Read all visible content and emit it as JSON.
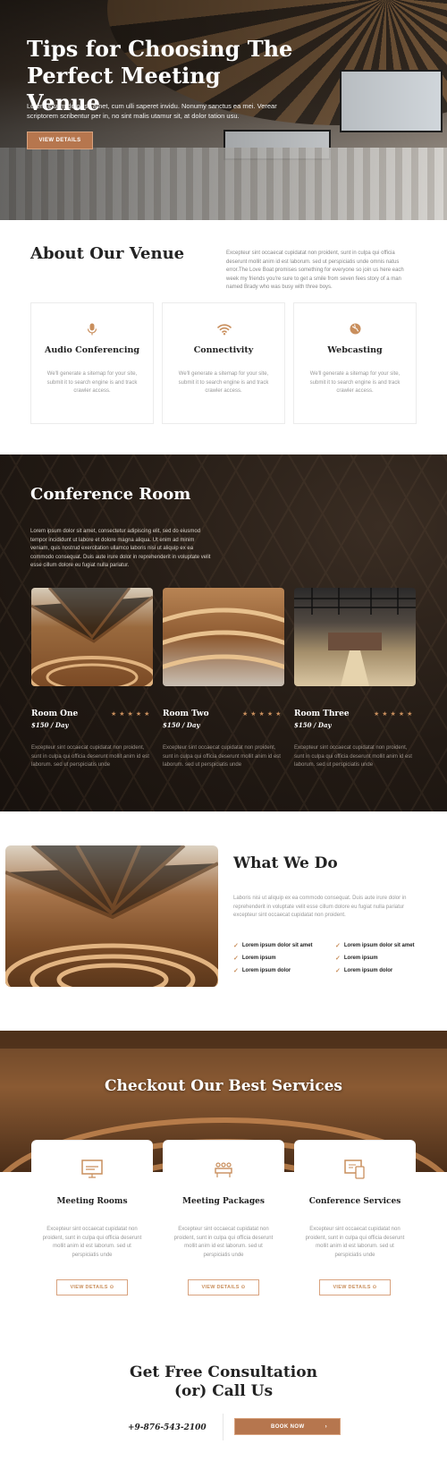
{
  "hero": {
    "title": "Tips for Choosing The Perfect Meeting Venue",
    "text": "Lorem ipsum dolor sit amet, cum ulli saperet invidu. Nonumy sanctus ea mei. Verear scriptorem scribentur per in, no sint malis utamur sit, at dolor tation usu.",
    "button": "VIEW DETAILS"
  },
  "about": {
    "title": "About Our Venue",
    "text": "Excepteur sint occaecat cupidatat non proident, sunt in culpa qui officia deserunt mollit anim id est laborum. sed ut perspiciatis unde omnis natus error.The Love Boat promises something for everyone so join us here each week my friends you're sure to get a smile from seven fees story of a man named Brady who was busy with three boys.",
    "features": [
      {
        "icon": "microphone-icon",
        "title": "Audio Conferencing",
        "text": "We'll generate a sitemap for your site, submit it to search engine is and track crawler access."
      },
      {
        "icon": "wifi-icon",
        "title": "Connectivity",
        "text": "We'll generate a sitemap for your site, submit it to search engine is and track crawler access."
      },
      {
        "icon": "globe-icon",
        "title": "Webcasting",
        "text": "We'll generate a sitemap for your site, submit it to search engine is and track crawler access."
      }
    ]
  },
  "conference": {
    "title": "Conference Room",
    "text": "Lorem ipsum dolor sit amet, consectetur adipiscing elit, sed do eiusmod tempor incididunt ut labore et dolore magna aliqua. Ut enim ad minim veniam, quis nostrud exercitation ullamco laboris nisi ut aliquip ex ea commodo consequat. Duis aute irure dolor in reprehenderit in voluptate velit esse cillum dolore eu fugiat nulla pariatur.",
    "rooms": [
      {
        "name": "Room One",
        "price": "$150 / Day",
        "stars": "★★★★★",
        "text": "Excepteur sint occaecat cupidatat non proident, sunt in culpa qui officia deserunt mollit anim id est laborum. sed ut perspiciatis unde"
      },
      {
        "name": "Room Two",
        "price": "$150 / Day",
        "stars": "★★★★★",
        "text": "Excepteur sint occaecat cupidatat non proident, sunt in culpa qui officia deserunt mollit anim id est laborum. sed ut perspiciatis unde"
      },
      {
        "name": "Room Three",
        "price": "$150 / Day",
        "stars": "★★★★★",
        "text": "Excepteur sint occaecat cupidatat non proident, sunt in culpa qui officia deserunt mollit anim id est laborum. sed ut perspiciatis unde"
      }
    ]
  },
  "what_we_do": {
    "title": "What We Do",
    "text": "Laboris nisi ut aliquip ex ea commodo consequat. Duis aute irure dolor in reprehenderit in voluptate velit esse cillum dolore eu fugiat nulla pariatur excepteur sint occaecat cupidatat non proident.",
    "checks": [
      "Lorem ipsum dolor sit amet",
      "Lorem ipsum dolor sit amet",
      "Lorem ipsum",
      "Lorem ipsum",
      "Lorem ipsum dolor",
      "Lorem ipsum dolor"
    ]
  },
  "services": {
    "title": "Checkout Our Best Services",
    "cards": [
      {
        "icon": "event-screen-icon",
        "title": "Meeting Rooms",
        "text": "Excepteur sint occaecat cupidatat non proident, sunt in culpa qui officia deserunt mollit anim id est laborum. sed ut perspiciatis unde",
        "button": "VIEW DETAILS ⊙"
      },
      {
        "icon": "meeting-table-icon",
        "title": "Meeting Packages",
        "text": "Excepteur sint occaecat cupidatat non proident, sunt in culpa qui officia deserunt mollit anim id est laborum. sed ut perspiciatis unde",
        "button": "VIEW DETAILS ⊙"
      },
      {
        "icon": "presentation-icon",
        "title": "Conference Services",
        "text": "Excepteur sint occaecat cupidatat non proident, sunt in culpa qui officia deserunt mollit anim id est laborum. sed ut perspiciatis unde",
        "button": "VIEW DETAILS ⊙"
      }
    ]
  },
  "cta": {
    "title_line1": "Get Free Consultation",
    "title_line2": "(or) Call Us",
    "phone": "+9-876-543-2100",
    "button": "BOOK NOW",
    "button_arrow": "›"
  },
  "colors": {
    "accent": "#c98f5d",
    "button": "#b6764e",
    "dark": "#1d1611"
  }
}
